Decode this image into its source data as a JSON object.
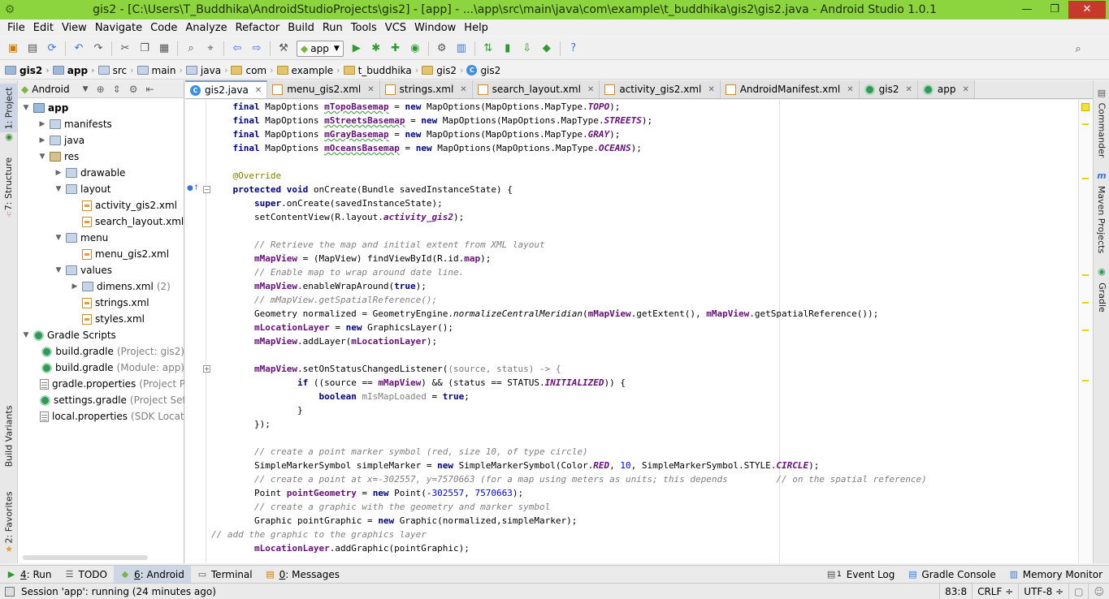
{
  "window": {
    "title": "gis2 - [C:\\Users\\T_Buddhika\\AndroidStudioProjects\\gis2] - [app] - ...\\app\\src\\main\\java\\com\\example\\t_buddhika\\gis2\\gis2.java - Android Studio 1.0.1",
    "minimize_label": "—",
    "restore_label": "❐",
    "close_label": "✕"
  },
  "menu": [
    "File",
    "Edit",
    "View",
    "Navigate",
    "Code",
    "Analyze",
    "Refactor",
    "Build",
    "Run",
    "Tools",
    "VCS",
    "Window",
    "Help"
  ],
  "toolbar": {
    "run_config": "app",
    "icons": [
      "open-icon",
      "save-icon",
      "sync-icon",
      "undo-icon",
      "redo-icon",
      "cut-icon",
      "copy-icon",
      "paste-icon",
      "find-icon",
      "replace-icon",
      "back-icon",
      "forward-icon",
      "make-icon",
      "run-icon",
      "debug-icon",
      "attach-icon",
      "coverage-icon",
      "profile-icon",
      "settings-icon",
      "project-structure-icon",
      "gradle-sync-icon",
      "avd-icon",
      "sdk-icon",
      "android-icon",
      "help-icon",
      "search-icon"
    ]
  },
  "breadcrumb": [
    "gis2",
    "app",
    "src",
    "main",
    "java",
    "com",
    "example",
    "t_buddhika",
    "gis2",
    "gis2"
  ],
  "left_tabs": [
    "1: Project",
    "7: Structure",
    "Build Variants",
    "2: Favorites"
  ],
  "project_panel": {
    "view_mode": "Android",
    "tree": [
      {
        "label": "app",
        "extra": "",
        "depth": 0,
        "expanded": true,
        "icon": "module"
      },
      {
        "label": "manifests",
        "extra": "",
        "depth": 1,
        "expanded": false,
        "icon": "folder"
      },
      {
        "label": "java",
        "extra": "",
        "depth": 1,
        "expanded": false,
        "icon": "folder"
      },
      {
        "label": "res",
        "extra": "",
        "depth": 1,
        "expanded": true,
        "icon": "res"
      },
      {
        "label": "drawable",
        "extra": "",
        "depth": 2,
        "expanded": false,
        "icon": "folder"
      },
      {
        "label": "layout",
        "extra": "",
        "depth": 2,
        "expanded": true,
        "icon": "folder"
      },
      {
        "label": "activity_gis2.xml",
        "extra": "",
        "depth": 3,
        "expanded": null,
        "icon": "xml"
      },
      {
        "label": "search_layout.xml",
        "extra": "",
        "depth": 3,
        "expanded": null,
        "icon": "xml"
      },
      {
        "label": "menu",
        "extra": "",
        "depth": 2,
        "expanded": true,
        "icon": "folder"
      },
      {
        "label": "menu_gis2.xml",
        "extra": "",
        "depth": 3,
        "expanded": null,
        "icon": "xml"
      },
      {
        "label": "values",
        "extra": "",
        "depth": 2,
        "expanded": true,
        "icon": "folder"
      },
      {
        "label": "dimens.xml",
        "extra": "(2)",
        "depth": 3,
        "expanded": false,
        "icon": "folder"
      },
      {
        "label": "strings.xml",
        "extra": "",
        "depth": 3,
        "expanded": null,
        "icon": "xml"
      },
      {
        "label": "styles.xml",
        "extra": "",
        "depth": 3,
        "expanded": null,
        "icon": "xml"
      },
      {
        "label": "Gradle Scripts",
        "extra": "",
        "depth": 0,
        "expanded": true,
        "icon": "gradle"
      },
      {
        "label": "build.gradle",
        "extra": "(Project: gis2)",
        "depth": 1,
        "expanded": null,
        "icon": "gradle"
      },
      {
        "label": "build.gradle",
        "extra": "(Module: app)",
        "depth": 1,
        "expanded": null,
        "icon": "gradle"
      },
      {
        "label": "gradle.properties",
        "extra": "(Project P",
        "depth": 1,
        "expanded": null,
        "icon": "props"
      },
      {
        "label": "settings.gradle",
        "extra": "(Project Sett",
        "depth": 1,
        "expanded": null,
        "icon": "gradle"
      },
      {
        "label": "local.properties",
        "extra": "(SDK Locati",
        "depth": 1,
        "expanded": null,
        "icon": "props"
      }
    ]
  },
  "editor_tabs": [
    {
      "label": "gis2.java",
      "icon": "class",
      "active": true
    },
    {
      "label": "menu_gis2.xml",
      "icon": "xml",
      "active": false
    },
    {
      "label": "strings.xml",
      "icon": "xml",
      "active": false
    },
    {
      "label": "search_layout.xml",
      "icon": "xml",
      "active": false
    },
    {
      "label": "activity_gis2.xml",
      "icon": "xml",
      "active": false
    },
    {
      "label": "AndroidManifest.xml",
      "icon": "xml",
      "active": false
    },
    {
      "label": "gis2",
      "icon": "gradle",
      "active": false
    },
    {
      "label": "app",
      "icon": "gradle",
      "active": false
    }
  ],
  "code_lines": [
    [
      [
        "    ",
        ""
      ],
      [
        "final",
        "kw"
      ],
      [
        " MapOptions ",
        ""
      ],
      [
        "mTopoBasemap",
        "fld wavy"
      ],
      [
        " = ",
        ""
      ],
      [
        "new",
        "kw"
      ],
      [
        " MapOptions(MapOptions.MapType.",
        ""
      ],
      [
        "TOPO",
        "cst"
      ],
      [
        ");",
        ""
      ]
    ],
    [
      [
        "    ",
        ""
      ],
      [
        "final",
        "kw"
      ],
      [
        " MapOptions ",
        ""
      ],
      [
        "mStreetsBasemap",
        "fld wavy"
      ],
      [
        " = ",
        ""
      ],
      [
        "new",
        "kw"
      ],
      [
        " MapOptions(MapOptions.MapType.",
        ""
      ],
      [
        "STREETS",
        "cst"
      ],
      [
        ");",
        ""
      ]
    ],
    [
      [
        "    ",
        ""
      ],
      [
        "final",
        "kw"
      ],
      [
        " MapOptions ",
        ""
      ],
      [
        "mGrayBasemap",
        "fld wavy"
      ],
      [
        " = ",
        ""
      ],
      [
        "new",
        "kw"
      ],
      [
        " MapOptions(MapOptions.MapType.",
        ""
      ],
      [
        "GRAY",
        "cst"
      ],
      [
        ");",
        ""
      ]
    ],
    [
      [
        "    ",
        ""
      ],
      [
        "final",
        "kw"
      ],
      [
        " MapOptions ",
        ""
      ],
      [
        "mOceansBasemap",
        "fld wavy"
      ],
      [
        " = ",
        ""
      ],
      [
        "new",
        "kw"
      ],
      [
        " MapOptions(MapOptions.MapType.",
        ""
      ],
      [
        "OCEANS",
        "cst"
      ],
      [
        ");",
        ""
      ]
    ],
    [
      [
        "",
        ""
      ]
    ],
    [
      [
        "    ",
        ""
      ],
      [
        "@Override",
        "ann"
      ]
    ],
    [
      [
        "    ",
        ""
      ],
      [
        "protected void",
        "kw"
      ],
      [
        " onCreate(Bundle savedInstanceState) {",
        ""
      ]
    ],
    [
      [
        "        ",
        ""
      ],
      [
        "super",
        "kw"
      ],
      [
        ".onCreate(savedInstanceState);",
        ""
      ]
    ],
    [
      [
        "        setContentView(R.layout.",
        ""
      ],
      [
        "activity_gis2",
        "cst"
      ],
      [
        ");",
        ""
      ]
    ],
    [
      [
        "",
        ""
      ]
    ],
    [
      [
        "        ",
        ""
      ],
      [
        "// Retrieve the map and initial extent from XML layout",
        "cm"
      ]
    ],
    [
      [
        "        ",
        ""
      ],
      [
        "mMapView",
        "fld"
      ],
      [
        " = (MapView) findViewById(R.id.",
        ""
      ],
      [
        "map",
        "fld"
      ],
      [
        ");",
        ""
      ]
    ],
    [
      [
        "        ",
        ""
      ],
      [
        "// Enable map to wrap around date line.",
        "cm"
      ]
    ],
    [
      [
        "        ",
        ""
      ],
      [
        "mMapView",
        "fld"
      ],
      [
        ".enableWrapAround(",
        ""
      ],
      [
        "true",
        "kw"
      ],
      [
        ");",
        ""
      ]
    ],
    [
      [
        "        ",
        ""
      ],
      [
        "// mMapView.getSpatialReference();",
        "cm"
      ]
    ],
    [
      [
        "        Geometry normalized = GeometryEngine.",
        ""
      ],
      [
        "normalizeCentralMeridian",
        "mth"
      ],
      [
        "(",
        ""
      ],
      [
        "mMapView",
        "fld"
      ],
      [
        ".getExtent(), ",
        ""
      ],
      [
        "mMapView",
        "fld"
      ],
      [
        ".getSpatialReference());",
        ""
      ]
    ],
    [
      [
        "        ",
        ""
      ],
      [
        "mLocationLayer",
        "fld"
      ],
      [
        " = ",
        ""
      ],
      [
        "new",
        "kw"
      ],
      [
        " GraphicsLayer();",
        ""
      ]
    ],
    [
      [
        "        ",
        ""
      ],
      [
        "mMapView",
        "fld"
      ],
      [
        ".addLayer(",
        ""
      ],
      [
        "mLocationLayer",
        "fld"
      ],
      [
        ");",
        ""
      ]
    ],
    [
      [
        "",
        ""
      ]
    ],
    [
      [
        "        ",
        ""
      ],
      [
        "mMapView",
        "fld"
      ],
      [
        ".setOnStatusChangedListener(",
        ""
      ],
      [
        "(source, status) -> {",
        "lam"
      ]
    ],
    [
      [
        "                ",
        ""
      ],
      [
        "if",
        "kw"
      ],
      [
        " ((source == ",
        ""
      ],
      [
        "mMapView",
        "fld"
      ],
      [
        ") && (status == STATUS.",
        ""
      ],
      [
        "INITIALIZED",
        "cst"
      ],
      [
        ")) {",
        ""
      ]
    ],
    [
      [
        "                    ",
        ""
      ],
      [
        "boolean",
        "kw"
      ],
      [
        " ",
        ""
      ],
      [
        "mIsMapLoaded",
        "gray"
      ],
      [
        " = ",
        ""
      ],
      [
        "true",
        "kw"
      ],
      [
        ";",
        ""
      ]
    ],
    [
      [
        "                }",
        ""
      ]
    ],
    [
      [
        "        });",
        ""
      ]
    ],
    [
      [
        "",
        ""
      ]
    ],
    [
      [
        "        ",
        ""
      ],
      [
        "// create a point marker symbol (red, size 10, of type circle)",
        "cm"
      ]
    ],
    [
      [
        "        SimpleMarkerSymbol simpleMarker = ",
        ""
      ],
      [
        "new",
        "kw"
      ],
      [
        " SimpleMarkerSymbol(Color.",
        ""
      ],
      [
        "RED",
        "cst"
      ],
      [
        ", ",
        ""
      ],
      [
        "10",
        "num"
      ],
      [
        ", SimpleMarkerSymbol.STYLE.",
        ""
      ],
      [
        "CIRCLE",
        "cst"
      ],
      [
        ");",
        ""
      ]
    ],
    [
      [
        "        ",
        ""
      ],
      [
        "// create a point at x=-302557, y=7570663 (for a map using meters as units; this depends         // on the spatial reference)",
        "cm"
      ]
    ],
    [
      [
        "        Point ",
        ""
      ],
      [
        "pointGeometry",
        "fld"
      ],
      [
        " = ",
        ""
      ],
      [
        "new",
        "kw"
      ],
      [
        " Point(-",
        ""
      ],
      [
        "302557",
        "num"
      ],
      [
        ", ",
        ""
      ],
      [
        "7570663",
        "num"
      ],
      [
        ");",
        ""
      ]
    ],
    [
      [
        "        ",
        ""
      ],
      [
        "// create a graphic with the geometry and marker symbol",
        "cm"
      ]
    ],
    [
      [
        "        Graphic pointGraphic = ",
        ""
      ],
      [
        "new",
        "kw"
      ],
      [
        " Graphic(normalized,simpleMarker);",
        ""
      ]
    ],
    [
      [
        "// add the graphic to the graphics layer",
        "cm"
      ]
    ],
    [
      [
        "        ",
        ""
      ],
      [
        "mLocationLayer",
        "fld"
      ],
      [
        ".addGraphic(pointGraphic);",
        ""
      ]
    ]
  ],
  "right_tabs": [
    "Commander",
    "Maven Projects",
    "Gradle"
  ],
  "bottom_tabs": [
    {
      "mnemonic": "4",
      "label": ": Run",
      "icon": "run-icon"
    },
    {
      "mnemonic": "",
      "label": "TODO",
      "icon": "todo-icon"
    },
    {
      "mnemonic": "6",
      "label": ": Android",
      "icon": "android-icon",
      "active": true
    },
    {
      "mnemonic": "",
      "label": "Terminal",
      "icon": "terminal-icon"
    },
    {
      "mnemonic": "0",
      "label": ": Messages",
      "icon": "messages-icon"
    }
  ],
  "bottom_right_tabs": [
    {
      "label": "Event Log",
      "badge": "1",
      "icon": "event-log-icon"
    },
    {
      "label": "Gradle Console",
      "icon": "gradle-console-icon"
    },
    {
      "label": "Memory Monitor",
      "icon": "memory-monitor-icon"
    }
  ],
  "status": {
    "message": "Session 'app': running (24 minutes ago)",
    "position": "83:8",
    "line_sep": "CRLF ÷",
    "encoding": "UTF-8 ÷"
  }
}
